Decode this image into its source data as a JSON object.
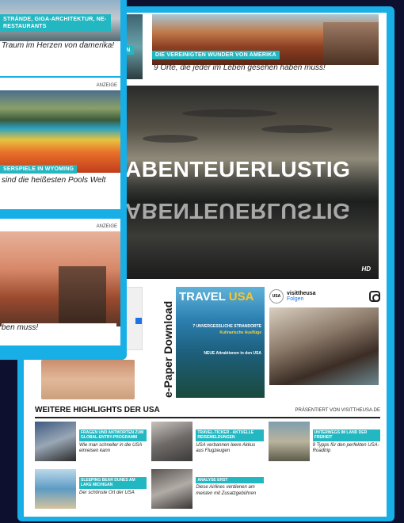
{
  "main": {
    "top_cards": [
      {
        "tag": "AN",
        "caption": ""
      },
      {
        "tag": "DIE VEREINIGTEN WUNDER VON AMERIKA",
        "caption": "9 Orte, die jeder im Leben gesehen haben muss!"
      }
    ],
    "video": {
      "title": "ABENTEUERLUSTIG",
      "badge": "HD"
    },
    "epaper": {
      "label": "e-Paper Download"
    },
    "magazine": {
      "title_main": "TRAVEL",
      "title_accent": "USA",
      "line1": "7 UNVERGESSLICHE STRANDORTE",
      "line2": "Kulinarische Ausflüge",
      "line3": "NEUE Attraktionen in den USA"
    },
    "instagram": {
      "logo": "USA",
      "name": "visittheusa",
      "follow": "Folgen"
    },
    "highlights": {
      "title": "WEITERE HIGHLIGHTS DER USA",
      "sponsor": "PRÄSENTIERT VON VISITTHEUSA.DE",
      "items": [
        {
          "tag": "FRAGEN UND ANTWORTEN ZUM GLOBAL-ENTRY-PROGRAMM",
          "desc": "Wie man schneller in die USA einreisen kann"
        },
        {
          "tag": "TRAVEL-TICKER - AKTUELLE REISEMELDUNGEN",
          "desc": "USA verbannen leere Akkus aus Flugzeugen"
        },
        {
          "tag": "UNTERWEGS IM LAND DER FREIHEIT",
          "desc": "9 Typps für den perfekten USA-Roadtrip"
        },
        {
          "tag": "SLEEPING BEAR DUNES AM LAKE MICHIGAN",
          "desc": "Der schönste Ort der USA"
        },
        {
          "tag": "ANALYSE ERST",
          "desc": "Diese Airlines verdienen am meisten mit Zusatzgebühren"
        }
      ]
    }
  },
  "overlay": {
    "card1": {
      "tag": "STRÄNDE, GIGA-ARCHITEKTUR, NE-RESTAURANTS",
      "caption": "Traum im Herzen von damerika!"
    },
    "card2": {
      "anzeige": "ANZEIGE",
      "tag": "SERSPIELE IN WYOMING",
      "caption": "sind die heißesten Pools Welt"
    },
    "card3": {
      "anzeige": "ANZEIGE",
      "caption": "ben muss!"
    }
  }
}
